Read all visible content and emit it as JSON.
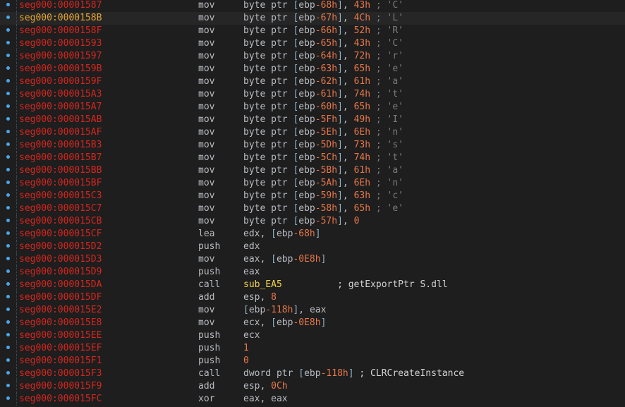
{
  "colors": {
    "background": "#1e1e1e",
    "address": "#d7261f",
    "address_current": "#e8a630",
    "mnemonic": "#b9bcc2",
    "stack_var": "#e8774a",
    "number": "#e8774a",
    "sub_name": "#f0d54a",
    "comment": "#7a7a7a",
    "gutter_dot": "#4aa6e8"
  },
  "gutter_icon": "breakpoint-dot-icon",
  "current_row": 1,
  "rows": [
    {
      "addr": "seg000:00001587",
      "mnem": "mov",
      "ops": [
        [
          "kw",
          "byte ptr "
        ],
        [
          "br",
          "["
        ],
        [
          "reg",
          "ebp"
        ],
        [
          "stack",
          "-68h"
        ],
        [
          "br",
          "]"
        ],
        [
          "pun",
          ", "
        ],
        [
          "num",
          "43h"
        ],
        [
          "com",
          " ; "
        ],
        [
          "chr",
          "'C'"
        ]
      ]
    },
    {
      "addr": "seg000:0000158B",
      "mnem": "mov",
      "ops": [
        [
          "kw",
          "byte ptr "
        ],
        [
          "br",
          "["
        ],
        [
          "reg",
          "ebp"
        ],
        [
          "stack",
          "-67h"
        ],
        [
          "br",
          "]"
        ],
        [
          "pun",
          ", "
        ],
        [
          "num",
          "4Ch"
        ],
        [
          "com",
          " ; "
        ],
        [
          "chr",
          "'L'"
        ]
      ]
    },
    {
      "addr": "seg000:0000158F",
      "mnem": "mov",
      "ops": [
        [
          "kw",
          "byte ptr "
        ],
        [
          "br",
          "["
        ],
        [
          "reg",
          "ebp"
        ],
        [
          "stack",
          "-66h"
        ],
        [
          "br",
          "]"
        ],
        [
          "pun",
          ", "
        ],
        [
          "num",
          "52h"
        ],
        [
          "com",
          " ; "
        ],
        [
          "chr",
          "'R'"
        ]
      ]
    },
    {
      "addr": "seg000:00001593",
      "mnem": "mov",
      "ops": [
        [
          "kw",
          "byte ptr "
        ],
        [
          "br",
          "["
        ],
        [
          "reg",
          "ebp"
        ],
        [
          "stack",
          "-65h"
        ],
        [
          "br",
          "]"
        ],
        [
          "pun",
          ", "
        ],
        [
          "num",
          "43h"
        ],
        [
          "com",
          " ; "
        ],
        [
          "chr",
          "'C'"
        ]
      ]
    },
    {
      "addr": "seg000:00001597",
      "mnem": "mov",
      "ops": [
        [
          "kw",
          "byte ptr "
        ],
        [
          "br",
          "["
        ],
        [
          "reg",
          "ebp"
        ],
        [
          "stack",
          "-64h"
        ],
        [
          "br",
          "]"
        ],
        [
          "pun",
          ", "
        ],
        [
          "num",
          "72h"
        ],
        [
          "com",
          " ; "
        ],
        [
          "chr",
          "'r'"
        ]
      ]
    },
    {
      "addr": "seg000:0000159B",
      "mnem": "mov",
      "ops": [
        [
          "kw",
          "byte ptr "
        ],
        [
          "br",
          "["
        ],
        [
          "reg",
          "ebp"
        ],
        [
          "stack",
          "-63h"
        ],
        [
          "br",
          "]"
        ],
        [
          "pun",
          ", "
        ],
        [
          "num",
          "65h"
        ],
        [
          "com",
          " ; "
        ],
        [
          "chr",
          "'e'"
        ]
      ]
    },
    {
      "addr": "seg000:0000159F",
      "mnem": "mov",
      "ops": [
        [
          "kw",
          "byte ptr "
        ],
        [
          "br",
          "["
        ],
        [
          "reg",
          "ebp"
        ],
        [
          "stack",
          "-62h"
        ],
        [
          "br",
          "]"
        ],
        [
          "pun",
          ", "
        ],
        [
          "num",
          "61h"
        ],
        [
          "com",
          " ; "
        ],
        [
          "chr",
          "'a'"
        ]
      ]
    },
    {
      "addr": "seg000:000015A3",
      "mnem": "mov",
      "ops": [
        [
          "kw",
          "byte ptr "
        ],
        [
          "br",
          "["
        ],
        [
          "reg",
          "ebp"
        ],
        [
          "stack",
          "-61h"
        ],
        [
          "br",
          "]"
        ],
        [
          "pun",
          ", "
        ],
        [
          "num",
          "74h"
        ],
        [
          "com",
          " ; "
        ],
        [
          "chr",
          "'t'"
        ]
      ]
    },
    {
      "addr": "seg000:000015A7",
      "mnem": "mov",
      "ops": [
        [
          "kw",
          "byte ptr "
        ],
        [
          "br",
          "["
        ],
        [
          "reg",
          "ebp"
        ],
        [
          "stack",
          "-60h"
        ],
        [
          "br",
          "]"
        ],
        [
          "pun",
          ", "
        ],
        [
          "num",
          "65h"
        ],
        [
          "com",
          " ; "
        ],
        [
          "chr",
          "'e'"
        ]
      ]
    },
    {
      "addr": "seg000:000015AB",
      "mnem": "mov",
      "ops": [
        [
          "kw",
          "byte ptr "
        ],
        [
          "br",
          "["
        ],
        [
          "reg",
          "ebp"
        ],
        [
          "stack",
          "-5Fh"
        ],
        [
          "br",
          "]"
        ],
        [
          "pun",
          ", "
        ],
        [
          "num",
          "49h"
        ],
        [
          "com",
          " ; "
        ],
        [
          "chr",
          "'I'"
        ]
      ]
    },
    {
      "addr": "seg000:000015AF",
      "mnem": "mov",
      "ops": [
        [
          "kw",
          "byte ptr "
        ],
        [
          "br",
          "["
        ],
        [
          "reg",
          "ebp"
        ],
        [
          "stack",
          "-5Eh"
        ],
        [
          "br",
          "]"
        ],
        [
          "pun",
          ", "
        ],
        [
          "num",
          "6Eh"
        ],
        [
          "com",
          " ; "
        ],
        [
          "chr",
          "'n'"
        ]
      ]
    },
    {
      "addr": "seg000:000015B3",
      "mnem": "mov",
      "ops": [
        [
          "kw",
          "byte ptr "
        ],
        [
          "br",
          "["
        ],
        [
          "reg",
          "ebp"
        ],
        [
          "stack",
          "-5Dh"
        ],
        [
          "br",
          "]"
        ],
        [
          "pun",
          ", "
        ],
        [
          "num",
          "73h"
        ],
        [
          "com",
          " ; "
        ],
        [
          "chr",
          "'s'"
        ]
      ]
    },
    {
      "addr": "seg000:000015B7",
      "mnem": "mov",
      "ops": [
        [
          "kw",
          "byte ptr "
        ],
        [
          "br",
          "["
        ],
        [
          "reg",
          "ebp"
        ],
        [
          "stack",
          "-5Ch"
        ],
        [
          "br",
          "]"
        ],
        [
          "pun",
          ", "
        ],
        [
          "num",
          "74h"
        ],
        [
          "com",
          " ; "
        ],
        [
          "chr",
          "'t'"
        ]
      ]
    },
    {
      "addr": "seg000:000015BB",
      "mnem": "mov",
      "ops": [
        [
          "kw",
          "byte ptr "
        ],
        [
          "br",
          "["
        ],
        [
          "reg",
          "ebp"
        ],
        [
          "stack",
          "-5Bh"
        ],
        [
          "br",
          "]"
        ],
        [
          "pun",
          ", "
        ],
        [
          "num",
          "61h"
        ],
        [
          "com",
          " ; "
        ],
        [
          "chr",
          "'a'"
        ]
      ]
    },
    {
      "addr": "seg000:000015BF",
      "mnem": "mov",
      "ops": [
        [
          "kw",
          "byte ptr "
        ],
        [
          "br",
          "["
        ],
        [
          "reg",
          "ebp"
        ],
        [
          "stack",
          "-5Ah"
        ],
        [
          "br",
          "]"
        ],
        [
          "pun",
          ", "
        ],
        [
          "num",
          "6Eh"
        ],
        [
          "com",
          " ; "
        ],
        [
          "chr",
          "'n'"
        ]
      ]
    },
    {
      "addr": "seg000:000015C3",
      "mnem": "mov",
      "ops": [
        [
          "kw",
          "byte ptr "
        ],
        [
          "br",
          "["
        ],
        [
          "reg",
          "ebp"
        ],
        [
          "stack",
          "-59h"
        ],
        [
          "br",
          "]"
        ],
        [
          "pun",
          ", "
        ],
        [
          "num",
          "63h"
        ],
        [
          "com",
          " ; "
        ],
        [
          "chr",
          "'c'"
        ]
      ]
    },
    {
      "addr": "seg000:000015C7",
      "mnem": "mov",
      "ops": [
        [
          "kw",
          "byte ptr "
        ],
        [
          "br",
          "["
        ],
        [
          "reg",
          "ebp"
        ],
        [
          "stack",
          "-58h"
        ],
        [
          "br",
          "]"
        ],
        [
          "pun",
          ", "
        ],
        [
          "num",
          "65h"
        ],
        [
          "com",
          " ; "
        ],
        [
          "chr",
          "'e'"
        ]
      ]
    },
    {
      "addr": "seg000:000015CB",
      "mnem": "mov",
      "ops": [
        [
          "kw",
          "byte ptr "
        ],
        [
          "br",
          "["
        ],
        [
          "reg",
          "ebp"
        ],
        [
          "stack",
          "-57h"
        ],
        [
          "br",
          "]"
        ],
        [
          "pun",
          ", "
        ],
        [
          "num",
          "0"
        ]
      ]
    },
    {
      "addr": "seg000:000015CF",
      "mnem": "lea",
      "ops": [
        [
          "reg",
          "edx"
        ],
        [
          "pun",
          ", "
        ],
        [
          "br",
          "["
        ],
        [
          "reg",
          "ebp"
        ],
        [
          "stack",
          "-68h"
        ],
        [
          "br",
          "]"
        ]
      ]
    },
    {
      "addr": "seg000:000015D2",
      "mnem": "push",
      "ops": [
        [
          "reg",
          "edx"
        ]
      ]
    },
    {
      "addr": "seg000:000015D3",
      "mnem": "mov",
      "ops": [
        [
          "reg",
          "eax"
        ],
        [
          "pun",
          ", "
        ],
        [
          "br",
          "["
        ],
        [
          "reg",
          "ebp"
        ],
        [
          "stack",
          "-0E8h"
        ],
        [
          "br",
          "]"
        ]
      ]
    },
    {
      "addr": "seg000:000015D9",
      "mnem": "push",
      "ops": [
        [
          "reg",
          "eax"
        ]
      ]
    },
    {
      "addr": "seg000:000015DA",
      "mnem": "call",
      "ops": [
        [
          "sub",
          "sub_EA5"
        ],
        [
          "pun",
          "          "
        ],
        [
          "cmt",
          "; getExportPtr S.dll"
        ]
      ]
    },
    {
      "addr": "seg000:000015DF",
      "mnem": "add",
      "ops": [
        [
          "reg",
          "esp"
        ],
        [
          "pun",
          ", "
        ],
        [
          "num",
          "8"
        ]
      ]
    },
    {
      "addr": "seg000:000015E2",
      "mnem": "mov",
      "ops": [
        [
          "br",
          "["
        ],
        [
          "reg",
          "ebp"
        ],
        [
          "stack",
          "-118h"
        ],
        [
          "br",
          "]"
        ],
        [
          "pun",
          ", "
        ],
        [
          "reg",
          "eax"
        ]
      ]
    },
    {
      "addr": "seg000:000015E8",
      "mnem": "mov",
      "ops": [
        [
          "reg",
          "ecx"
        ],
        [
          "pun",
          ", "
        ],
        [
          "br",
          "["
        ],
        [
          "reg",
          "ebp"
        ],
        [
          "stack",
          "-0E8h"
        ],
        [
          "br",
          "]"
        ]
      ]
    },
    {
      "addr": "seg000:000015EE",
      "mnem": "push",
      "ops": [
        [
          "reg",
          "ecx"
        ]
      ]
    },
    {
      "addr": "seg000:000015EF",
      "mnem": "push",
      "ops": [
        [
          "num",
          "1"
        ]
      ]
    },
    {
      "addr": "seg000:000015F1",
      "mnem": "push",
      "ops": [
        [
          "num",
          "0"
        ]
      ]
    },
    {
      "addr": "seg000:000015F3",
      "mnem": "call",
      "ops": [
        [
          "kw",
          "dword ptr "
        ],
        [
          "br",
          "["
        ],
        [
          "reg",
          "ebp"
        ],
        [
          "stack",
          "-118h"
        ],
        [
          "br",
          "]"
        ],
        [
          "pun",
          " "
        ],
        [
          "cmt",
          "; CLRCreateInstance"
        ]
      ]
    },
    {
      "addr": "seg000:000015F9",
      "mnem": "add",
      "ops": [
        [
          "reg",
          "esp"
        ],
        [
          "pun",
          ", "
        ],
        [
          "num",
          "0Ch"
        ]
      ]
    },
    {
      "addr": "seg000:000015FC",
      "mnem": "xor",
      "ops": [
        [
          "reg",
          "eax"
        ],
        [
          "pun",
          ", "
        ],
        [
          "reg",
          "eax"
        ]
      ]
    }
  ]
}
